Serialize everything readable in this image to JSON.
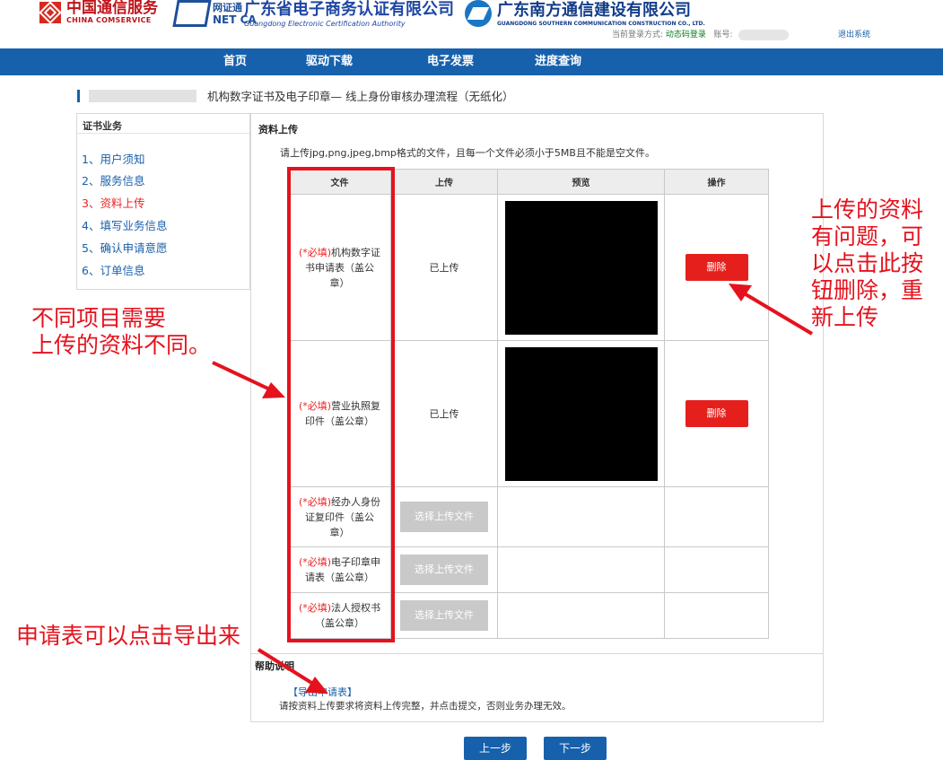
{
  "header": {
    "logos": {
      "comservice_cn": "中国通信服务",
      "comservice_en": "CHINA COMSERVICE",
      "netca_cn": "网证通",
      "netca_en": "NET CA",
      "gdca_cn": "广东省电子商务认证有限公司",
      "gdca_en": "Guangdong Electronic Certification Authority",
      "southern_cn": "广东南方通信建设有限公司",
      "southern_en": "GUANGDONG SOUTHERN COMMUNICATION CONSTRUCTION CO., LTD."
    },
    "login_label": "当前登录方式:",
    "login_method": "动态码登录",
    "account_label": "账号:",
    "logout": "退出系统"
  },
  "nav": {
    "items": [
      "首页",
      "驱动下载",
      "电子发票",
      "进度查询"
    ]
  },
  "breadcrumb": {
    "title": "机构数字证书及电子印章— 线上身份审核办理流程（无纸化）"
  },
  "sidebar": {
    "title": "证书业务",
    "items": [
      {
        "label": "1、用户须知"
      },
      {
        "label": "2、服务信息"
      },
      {
        "label": "3、资料上传",
        "active": true
      },
      {
        "label": "4、填写业务信息"
      },
      {
        "label": "5、确认申请意愿"
      },
      {
        "label": "6、订单信息"
      }
    ]
  },
  "upload": {
    "section_title": "资料上传",
    "tip": "请上传jpg,png,jpeg,bmp格式的文件，且每一个文件必须小于5MB且不能是空文件。",
    "columns": [
      "文件",
      "上传",
      "预览",
      "操作"
    ],
    "required_prefix": "(*必填)",
    "rows": [
      {
        "name": "机构数字证书申请表（盖公章）",
        "status": "已上传",
        "action": "删除"
      },
      {
        "name": "营业执照复印件（盖公章）",
        "status": "已上传",
        "action": "删除"
      },
      {
        "name": "经办人身份证复印件（盖公章）",
        "choose": "选择上传文件"
      },
      {
        "name": "电子印章申请表（盖公章）",
        "choose": "选择上传文件"
      },
      {
        "name": "法人授权书（盖公章）",
        "choose": "选择上传文件"
      }
    ]
  },
  "help": {
    "title": "帮助说明",
    "export_link": "【导出申请表】",
    "desc": "请按资料上传要求将资料上传完整，并点击提交，否则业务办理无效。"
  },
  "footer": {
    "prev": "上一步",
    "next": "下一步"
  },
  "annotations": {
    "delete_note": [
      "上传的资料",
      "有问题，可",
      "以点击此按",
      "钮删除，重",
      "新上传"
    ],
    "items_note": [
      "不同项目需要",
      "上传的资料不同。"
    ],
    "export_note": "申请表可以点击导出来"
  },
  "colors": {
    "nav_blue": "#1761ac",
    "annotation_red": "#e5121d",
    "delete_red": "#e5201c"
  }
}
